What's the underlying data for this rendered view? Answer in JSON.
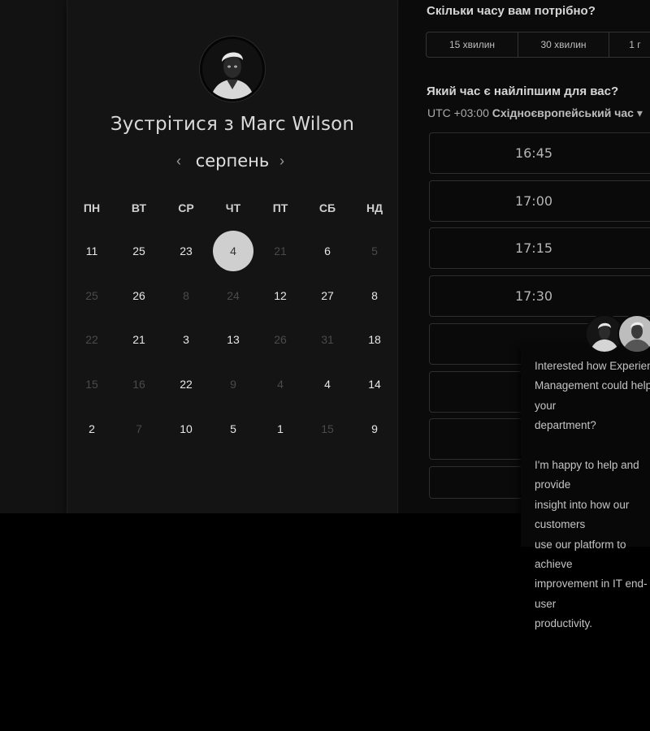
{
  "calendar": {
    "title": "Зустрітися з Marc Wilson",
    "month": "серпень",
    "prev_icon": "‹",
    "next_icon": "›",
    "weekdays": [
      "ПН",
      "ВТ",
      "СР",
      "ЧТ",
      "ПТ",
      "СБ",
      "НД"
    ],
    "weeks": [
      [
        {
          "d": "11",
          "dim": false
        },
        {
          "d": "25",
          "dim": false
        },
        {
          "d": "23",
          "dim": false
        },
        {
          "d": "4",
          "dim": false,
          "selected": true
        },
        {
          "d": "21",
          "dim": true
        },
        {
          "d": "6",
          "dim": false
        },
        {
          "d": "5",
          "dim": true
        }
      ],
      [
        {
          "d": "25",
          "dim": true
        },
        {
          "d": "26",
          "dim": false
        },
        {
          "d": "8",
          "dim": true
        },
        {
          "d": "24",
          "dim": true
        },
        {
          "d": "12",
          "dim": false
        },
        {
          "d": "27",
          "dim": false
        },
        {
          "d": "8",
          "dim": false
        }
      ],
      [
        {
          "d": "22",
          "dim": true
        },
        {
          "d": "21",
          "dim": false
        },
        {
          "d": "3",
          "dim": false
        },
        {
          "d": "13",
          "dim": false
        },
        {
          "d": "26",
          "dim": true
        },
        {
          "d": "31",
          "dim": true
        },
        {
          "d": "18",
          "dim": false
        }
      ],
      [
        {
          "d": "15",
          "dim": true
        },
        {
          "d": "16",
          "dim": true
        },
        {
          "d": "22",
          "dim": false
        },
        {
          "d": "9",
          "dim": true
        },
        {
          "d": "4",
          "dim": true
        },
        {
          "d": "4",
          "dim": false
        },
        {
          "d": "14",
          "dim": false
        }
      ],
      [
        {
          "d": "2",
          "dim": false
        },
        {
          "d": "7",
          "dim": true
        },
        {
          "d": "10",
          "dim": false
        },
        {
          "d": "5",
          "dim": false
        },
        {
          "d": "1",
          "dim": false
        },
        {
          "d": "15",
          "dim": true
        },
        {
          "d": "9",
          "dim": false
        }
      ]
    ]
  },
  "booking": {
    "duration_question": "Скільки часу вам потрібно?",
    "durations": [
      "15 хвилин",
      "30 хвилин",
      "1 г"
    ],
    "time_question": "Який час є найліпшим для вас?",
    "timezone_offset": "UTC +03:00",
    "timezone_name": "Східноєвропейський час",
    "timezone_caret": "▾",
    "slots": [
      "16:45",
      "17:00",
      "17:15",
      "17:30",
      "",
      "",
      "",
      ""
    ]
  },
  "chat": {
    "message": "Interested how Experience\nManagement could help your\ndepartment?\n\nI'm happy to help and provide\ninsight into how our customers\nuse our platform to achieve\nimprovement in IT end-user\nproductivity."
  }
}
